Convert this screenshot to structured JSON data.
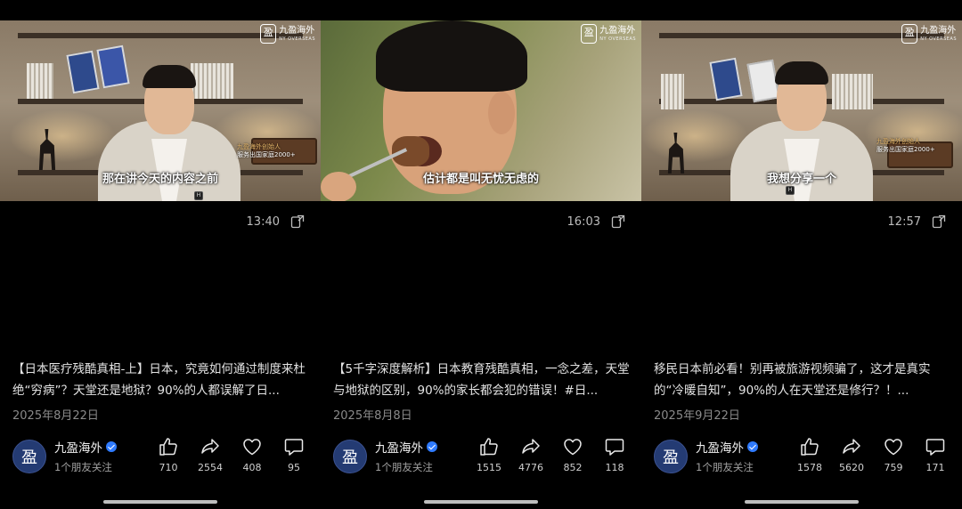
{
  "brand": {
    "watermark_name": "九盈海外",
    "watermark_en": "NY OVERSEAS",
    "logo_glyph": "盈",
    "accent_color": "#2f7bff"
  },
  "posts": [
    {
      "subtitle": "那在讲今天的内容之前",
      "overlay_line1": "九盈海外创始人",
      "overlay_line2": "服务出国家庭2000+",
      "duration": "13:40",
      "description": "【日本医疗残酷真相-上】日本，究竟如何通过制度来杜绝“穷病”？天堂还是地狱？90%的人都误解了日...",
      "date": "2025年8月22日",
      "author": "九盈海外",
      "friends": "1个朋友关注",
      "likes": "710",
      "shares": "2554",
      "favorites": "408",
      "comments": "95"
    },
    {
      "subtitle": "估计都是叫无忧无虑的",
      "overlay_line1": "",
      "overlay_line2": "",
      "duration": "16:03",
      "description": "【5千字深度解析】日本教育残酷真相，一念之差，天堂与地狱的区别，90%的家长都会犯的错误！#日...",
      "date": "2025年8月8日",
      "author": "九盈海外",
      "friends": "1个朋友关注",
      "likes": "1515",
      "shares": "4776",
      "favorites": "852",
      "comments": "118"
    },
    {
      "subtitle": "我想分享一个",
      "overlay_line1": "九盈海外创始人",
      "overlay_line2": "服务出国家庭2000+",
      "duration": "12:57",
      "description": "移民日本前必看！别再被旅游视频骗了，这才是真实的“冷暖自知”，90%的人在天堂还是修行？！...",
      "date": "2025年9月22日",
      "author": "九盈海外",
      "friends": "1个朋友关注",
      "likes": "1578",
      "shares": "5620",
      "favorites": "759",
      "comments": "171"
    }
  ],
  "icons": {
    "share_out": "share-out-icon",
    "like": "thumbs-up-icon",
    "share": "share-arrow-icon",
    "favorite": "heart-icon",
    "comment": "comment-bubble-icon",
    "verified": "verified-badge-icon"
  }
}
